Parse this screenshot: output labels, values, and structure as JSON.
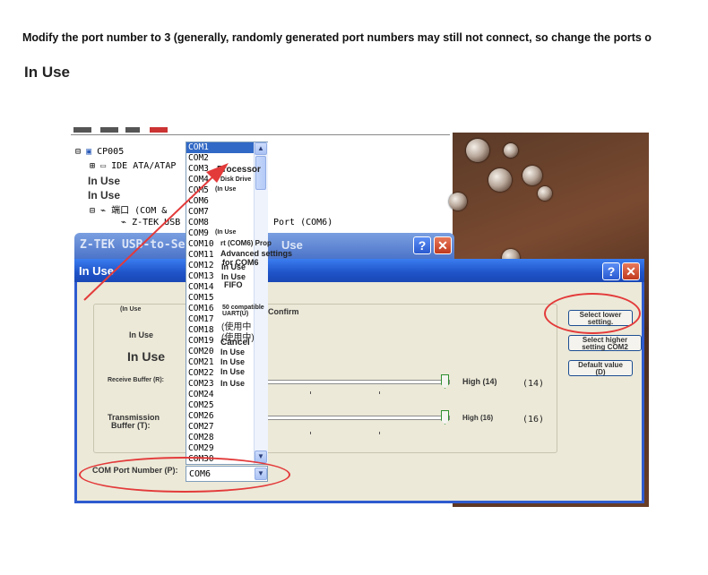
{
  "instruction": "Modify the port number to 3 (generally, randomly generated port numbers may still not connect, so change the ports o",
  "heading": "In Use",
  "tree": {
    "computer": "CP005",
    "ide": "IDE ATA/ATAP",
    "in_use_1": "In Use",
    "in_use_2": "In Use",
    "ports": "端口 (COM &",
    "port_item": "Z-TEK USB",
    "port_suffix": "Port (COM6)"
  },
  "back_window_title": "Z-TEK USB-to-Se",
  "back_window_suffix": "Use",
  "dialog": {
    "title": "In Use",
    "in_use_small": "(In Use",
    "confirm": "Confirm",
    "in_use_mid": "In Use",
    "in_use_large": "In Use",
    "receive_label": "Receive Buffer (R):",
    "receive_high": "High (14)",
    "receive_value": "(14)",
    "transmit_label_1": "Transmission",
    "transmit_label_2": "Buffer (T):",
    "transmit_high": "High (16)",
    "transmit_value": "(16)",
    "com_label": "COM Port Number (P):",
    "combo_value": "COM6",
    "btn_lower_1": "Select lower",
    "btn_lower_2": "setting.",
    "btn_higher_1": "Select higher",
    "btn_higher_2": "setting COM2",
    "btn_default_1": "Default value",
    "btn_default_2": "(D)"
  },
  "dropdown": {
    "items": [
      "COM1",
      "COM2",
      "COM3",
      "COM4",
      "COM5",
      "COM6",
      "COM7",
      "COM8",
      "COM9",
      "COM10",
      "COM11",
      "COM12",
      "COM13",
      "COM14",
      "COM15",
      "COM16",
      "COM17",
      "COM18",
      "COM19",
      "COM20",
      "COM21",
      "COM22",
      "COM23",
      "COM24",
      "COM25",
      "COM26",
      "COM27",
      "COM28",
      "COM29",
      "COM30"
    ],
    "selected": "COM1"
  },
  "overlay": {
    "processor": "Processor",
    "disk": "Disk Drive",
    "in_use_a": "(In Use",
    "in_use_b": "(In Use",
    "prop": "rt (COM6) Prop",
    "adv": "Advanced settings",
    "for": "for COM6",
    "iu1": "In Use",
    "iu2": "In Use",
    "fifo": "FIFO",
    "compat_1": "50 compatible",
    "compat_2": "UART(U)",
    "used1": "(使用中",
    "used2": "(使用中)",
    "cancel": "Cancel",
    "iu3": "In Use",
    "iu4": "In Use",
    "iu5": "In Use",
    "iu6": "In Use"
  },
  "colors": {
    "annotation_red": "#e33a3a",
    "xp_title_blue": "#2f5bd0",
    "list_selection": "#3169c6"
  }
}
